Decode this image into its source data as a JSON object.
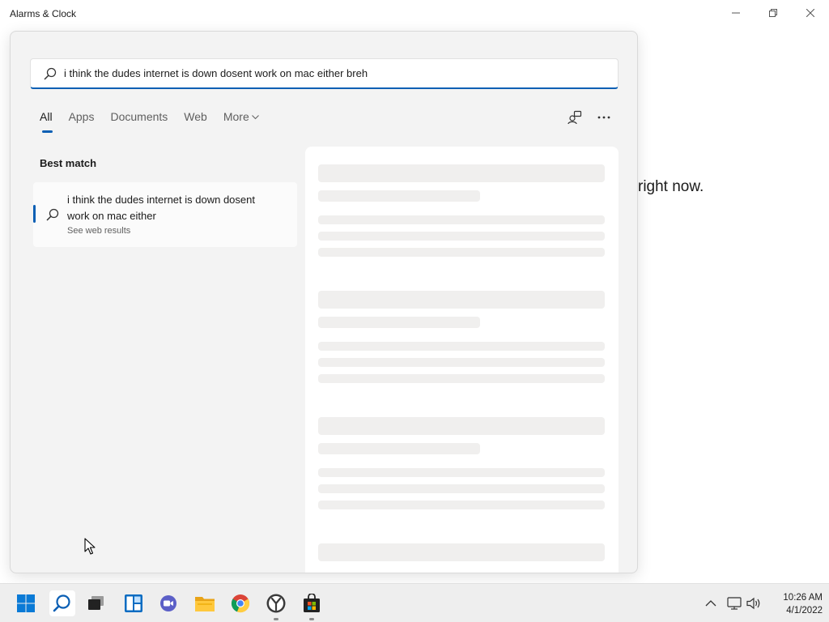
{
  "window": {
    "title": "Alarms & Clock",
    "controls": [
      "minimize",
      "maximize",
      "close"
    ]
  },
  "background_app": {
    "visible_text": "right now."
  },
  "search": {
    "query": "i think the dudes internet is down dosent work on mac either breh",
    "tabs": [
      {
        "label": "All",
        "active": true
      },
      {
        "label": "Apps",
        "active": false
      },
      {
        "label": "Documents",
        "active": false
      },
      {
        "label": "Web",
        "active": false
      },
      {
        "label": "More",
        "active": false,
        "icon": "chevron-down-icon"
      }
    ],
    "toolbar_icons": [
      "account-switch-icon",
      "more-options-icon"
    ],
    "best_match_label": "Best match",
    "best_match": {
      "title": "i think the dudes internet is down dosent work on mac either",
      "subtitle": "See web results",
      "icon": "search-icon"
    },
    "preview_state": "loading"
  },
  "taskbar": {
    "pinned": [
      "start-icon",
      "search-icon",
      "task-view-icon",
      "widgets-icon",
      "chat-icon",
      "file-explorer-icon",
      "chrome-icon",
      "alarms-clock-icon",
      "store-icon"
    ],
    "tray": [
      "show-hidden-icons-chevron",
      "network-icon",
      "volume-icon"
    ],
    "time": "10:26 AM",
    "date": "4/1/2022"
  },
  "colors": {
    "accent": "#0a5fb4",
    "flyout_bg": "#f3f3f3",
    "skeleton": "#f0efee",
    "taskbar_bg": "#eeeeee"
  }
}
